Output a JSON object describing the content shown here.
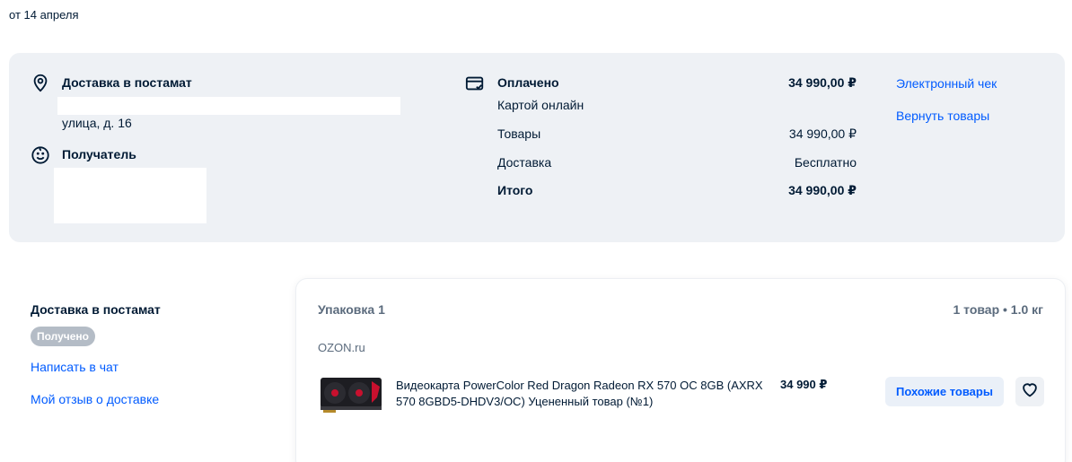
{
  "order": {
    "date": "от 14 апреля"
  },
  "delivery": {
    "title": "Доставка в постамат",
    "address_line": "улица, д. 16"
  },
  "recipient": {
    "title": "Получатель"
  },
  "payment": {
    "status": "Оплачено",
    "method": "Картой онлайн",
    "total_paid": "34 990,00 ₽",
    "rows": [
      {
        "label": "Товары",
        "value": "34 990,00 ₽"
      },
      {
        "label": "Доставка",
        "value": "Бесплатно"
      },
      {
        "label": "Итого",
        "value": "34 990,00 ₽"
      }
    ]
  },
  "actions": {
    "receipt": "Электронный чек",
    "return": "Вернуть товары"
  },
  "shipment": {
    "title": "Доставка в постамат",
    "status": "Получено",
    "chat_link": "Написать в чат",
    "review_link": "Мой отзыв о доставке"
  },
  "package": {
    "title": "Упаковка 1",
    "meta": "1 товар • 1.0 кг",
    "seller": "OZON.ru",
    "item": {
      "name": "Видеокарта PowerColor Red Dragon Radeon RX 570 OC 8GB (AXRX 570 8GBD5-DHDV3/OC) Уцененный товар (№1)",
      "price": "34 990 ₽",
      "similar_label": "Похожие товары"
    }
  },
  "colors": {
    "link": "#005bff",
    "panel": "#eef1f5",
    "badge": "#b4bcc6",
    "text": "#001a34"
  },
  "icons": [
    "location-pin-icon",
    "smile-icon",
    "card-icon",
    "heart-icon"
  ]
}
